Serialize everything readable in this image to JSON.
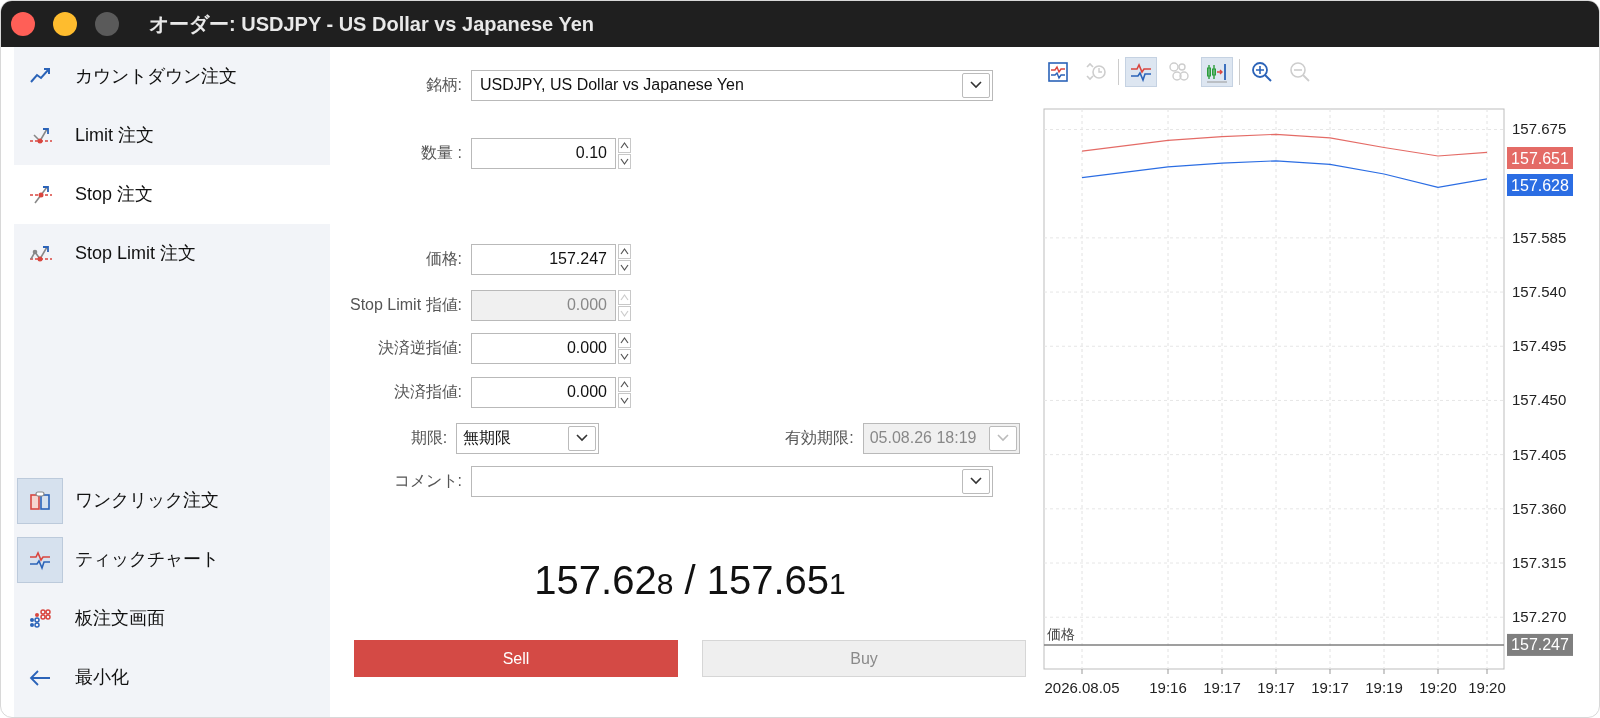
{
  "window": {
    "title": "オーダー: USDJPY - US Dollar vs Japanese Yen"
  },
  "sidebar": {
    "order_types": [
      {
        "kind": "countdown",
        "label": "カウントダウン注文",
        "selected": false
      },
      {
        "kind": "limit",
        "label": "Limit 注文",
        "selected": false
      },
      {
        "kind": "stop",
        "label": "Stop 注文",
        "selected": true
      },
      {
        "kind": "stop-limit",
        "label": "Stop Limit 注文",
        "selected": false
      }
    ],
    "tools": [
      {
        "kind": "one-click",
        "label": "ワンクリック注文",
        "on": true
      },
      {
        "kind": "tick-chart",
        "label": "ティックチャート",
        "on": true
      },
      {
        "kind": "depth",
        "label": "板注文画面",
        "on": false
      },
      {
        "kind": "minimize",
        "label": "最小化",
        "on": false
      }
    ]
  },
  "form": {
    "symbol": {
      "label": "銘柄:",
      "value": "USDJPY, US Dollar vs Japanese Yen"
    },
    "volume": {
      "label": "数量 :",
      "value": "0.10",
      "disabled": false
    },
    "price": {
      "label": "価格:",
      "value": "157.247",
      "disabled": false
    },
    "stop_limit": {
      "label": "Stop Limit 指値:",
      "value": "0.000",
      "disabled": true
    },
    "stop_loss": {
      "label": "決済逆指値:",
      "value": "0.000",
      "disabled": false
    },
    "take_profit": {
      "label": "決済指値:",
      "value": "0.000",
      "disabled": false
    },
    "expiration": {
      "label": "期限:",
      "value": "無期限"
    },
    "expiry_date": {
      "label": "有効期限:",
      "value": "05.08.26 18:19",
      "disabled": true
    },
    "comment": {
      "label": "コメント:"
    }
  },
  "quote": {
    "bid": "157.62",
    "bid_last": "8",
    "separator": "/",
    "ask": "157.65",
    "ask_last": "1"
  },
  "buttons": [
    {
      "kind": "sell",
      "label": "Sell",
      "disabled": false
    },
    {
      "kind": "buy",
      "label": "Buy",
      "disabled": true
    }
  ],
  "chart": {
    "toolbar": [
      {
        "kind": "chart-window",
        "on": false,
        "disabled": false
      },
      {
        "kind": "clock-arrows",
        "on": false,
        "disabled": true
      },
      {
        "kind": "tick-lines",
        "on": true,
        "disabled": false
      },
      {
        "kind": "bubbles",
        "on": false,
        "disabled": true
      },
      {
        "kind": "chart-shift",
        "on": true,
        "disabled": false
      },
      {
        "kind": "zoom-in",
        "on": false,
        "disabled": false
      },
      {
        "kind": "zoom-out",
        "on": false,
        "disabled": true
      }
    ],
    "chart_data": {
      "type": "line",
      "categories": [
        "2026.08.05",
        "19:16",
        "19:17",
        "19:17",
        "19:17",
        "19:19",
        "19:20",
        "19:20"
      ],
      "grid": true,
      "ref_lines": [
        {
          "axis": "y",
          "value": 157.247,
          "label": "価格",
          "color": "#7f7f7f"
        }
      ],
      "annotations": [
        "157.247"
      ],
      "series": [
        {
          "color": "#e46b66",
          "values": [
            157.657,
            157.666,
            157.669,
            157.671,
            157.668,
            157.66,
            157.653,
            157.656
          ]
        },
        {
          "color": "#2b6de3",
          "values": [
            157.635,
            157.644,
            157.647,
            157.649,
            157.646,
            157.638,
            157.627,
            157.634
          ]
        }
      ],
      "ylim": [
        157.227,
        157.692
      ],
      "yticks": [
        {
          "value": 157.675,
          "label": "157.675"
        },
        {
          "value": 157.585,
          "label": "157.585"
        },
        {
          "value": 157.54,
          "label": "157.540"
        },
        {
          "value": 157.495,
          "label": "157.495"
        },
        {
          "value": 157.45,
          "label": "157.450"
        },
        {
          "value": 157.405,
          "label": "157.405"
        },
        {
          "value": 157.36,
          "label": "157.360"
        },
        {
          "value": 157.315,
          "label": "157.315"
        },
        {
          "value": 157.27,
          "label": "157.270"
        }
      ]
    },
    "price_tags": [
      {
        "text": "157.651",
        "color": "#e46b66"
      },
      {
        "text": "157.628",
        "color": "#2b6de3"
      }
    ]
  }
}
